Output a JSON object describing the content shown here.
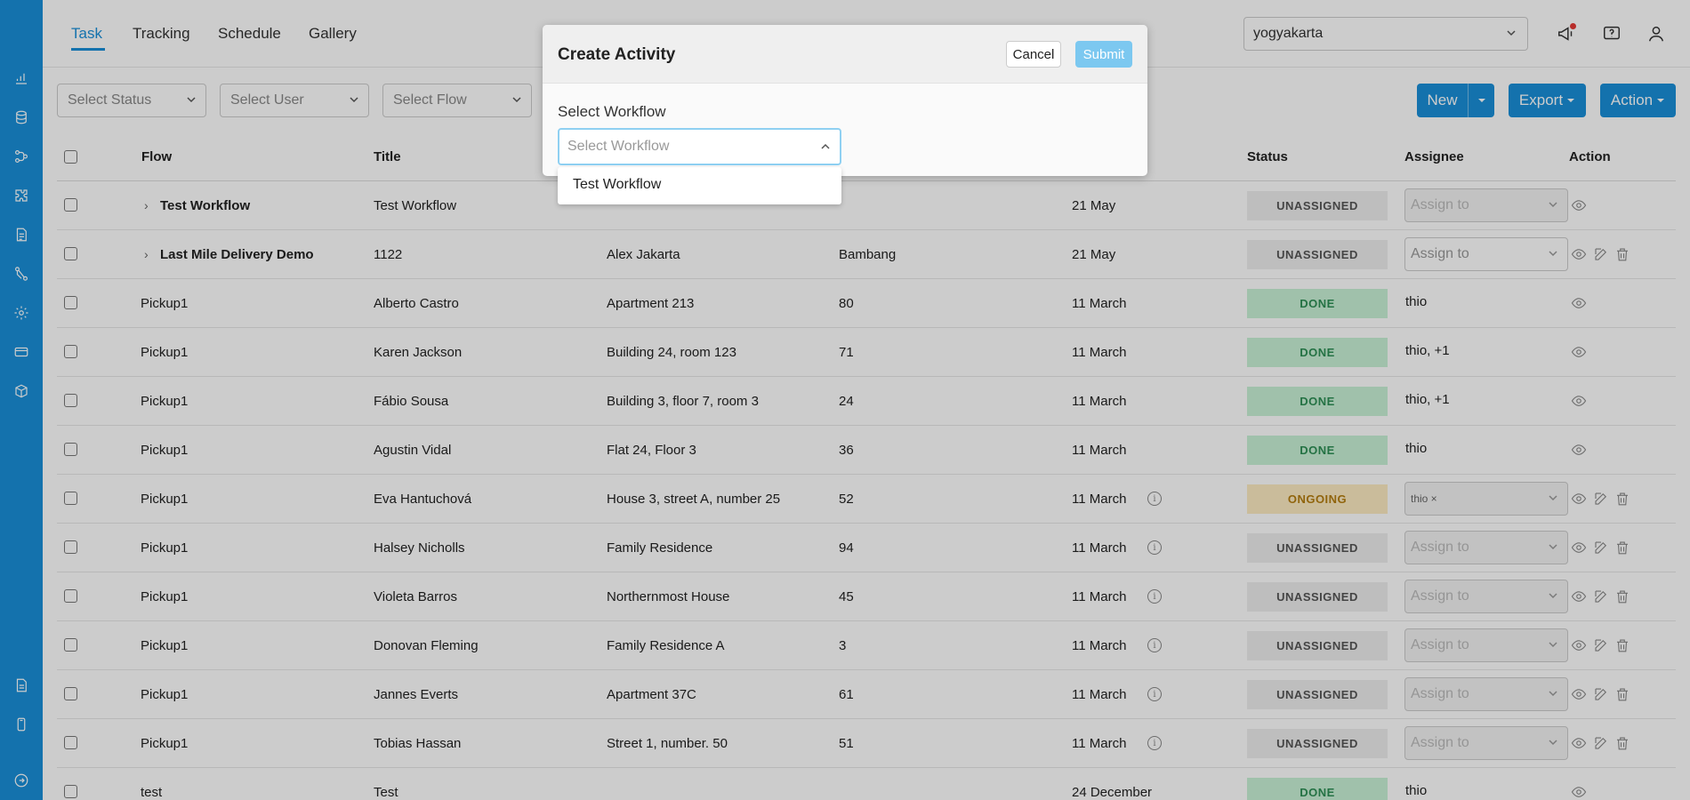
{
  "tabs": [
    "Task",
    "Tracking",
    "Schedule",
    "Gallery"
  ],
  "city": "yogyakarta",
  "filters": {
    "status": "Select Status",
    "user": "Select User",
    "flow": "Select Flow"
  },
  "buttons": {
    "new": "New",
    "export": "Export",
    "action": "Action"
  },
  "columns": {
    "flow": "Flow",
    "title": "Title",
    "status": "Status",
    "assignee": "Assignee",
    "action": "Action"
  },
  "rows": [
    {
      "flow": "Test Workflow",
      "title": "Test Workflow",
      "address": "",
      "num": "",
      "date": "21 May",
      "status": "UNASSIGNED",
      "assignee": "Assign to"
    },
    {
      "flow": "Last Mile Delivery Demo",
      "title": "1122",
      "address": "Alex Jakarta",
      "num": "Bambang",
      "date": "21 May",
      "status": "UNASSIGNED",
      "assignee": "Assign to"
    },
    {
      "flow": "Pickup1",
      "title": "Alberto Castro",
      "address": "Apartment 213",
      "num": "80",
      "date": "11 March",
      "status": "DONE",
      "assignee": "thio"
    },
    {
      "flow": "Pickup1",
      "title": "Karen Jackson",
      "address": "Building 24, room 123",
      "num": "71",
      "date": "11 March",
      "status": "DONE",
      "assignee": "thio, +1"
    },
    {
      "flow": "Pickup1",
      "title": "Fábio Sousa",
      "address": "Building 3, floor 7, room 3",
      "num": "24",
      "date": "11 March",
      "status": "DONE",
      "assignee": "thio, +1"
    },
    {
      "flow": "Pickup1",
      "title": "Agustin Vidal",
      "address": "Flat 24, Floor 3",
      "num": "36",
      "date": "11 March",
      "status": "DONE",
      "assignee": "thio"
    },
    {
      "flow": "Pickup1",
      "title": "Eva Hantuchová",
      "address": "House 3, street A, number 25",
      "num": "52",
      "date": "11 March",
      "status": "ONGOING",
      "assignee": "thio ×"
    },
    {
      "flow": "Pickup1",
      "title": "Halsey Nicholls",
      "address": "Family Residence",
      "num": "94",
      "date": "11 March",
      "status": "UNASSIGNED",
      "assignee": "Assign to"
    },
    {
      "flow": "Pickup1",
      "title": "Violeta Barros",
      "address": "Northernmost House",
      "num": "45",
      "date": "11 March",
      "status": "UNASSIGNED",
      "assignee": "Assign to"
    },
    {
      "flow": "Pickup1",
      "title": "Donovan Fleming",
      "address": "Family Residence A",
      "num": "3",
      "date": "11 March",
      "status": "UNASSIGNED",
      "assignee": "Assign to"
    },
    {
      "flow": "Pickup1",
      "title": "Jannes Everts",
      "address": "Apartment 37C",
      "num": "61",
      "date": "11 March",
      "status": "UNASSIGNED",
      "assignee": "Assign to"
    },
    {
      "flow": "Pickup1",
      "title": "Tobias Hassan",
      "address": "Street 1, number. 50",
      "num": "51",
      "date": "11 March",
      "status": "UNASSIGNED",
      "assignee": "Assign to"
    },
    {
      "flow": "test",
      "title": "Test",
      "address": "",
      "num": "",
      "date": "24 December",
      "status": "DONE",
      "assignee": "thio"
    }
  ],
  "modal": {
    "title": "Create Activity",
    "cancel": "Cancel",
    "submit": "Submit",
    "field_label": "Select Workflow",
    "placeholder": "Select Workflow",
    "options": [
      "Test Workflow"
    ]
  },
  "colors": {
    "brand": "#1a8fd9",
    "done": "#c9f2d6",
    "ongoing": "#fdecc2",
    "unassigned": "#eeeeee"
  }
}
